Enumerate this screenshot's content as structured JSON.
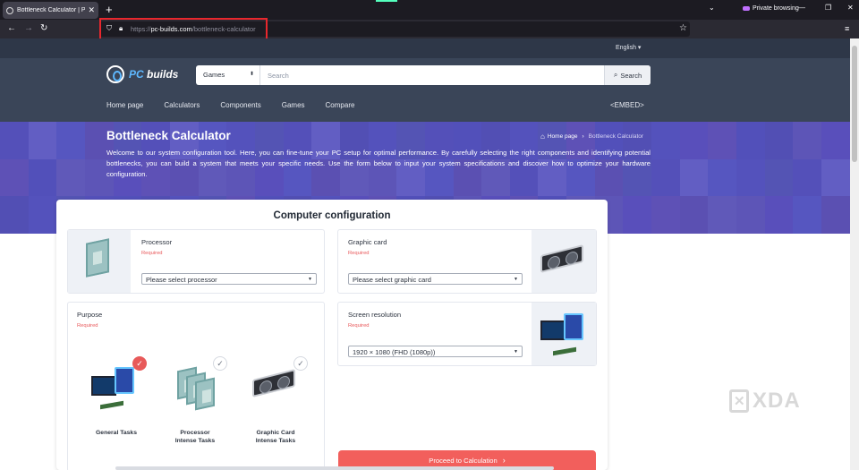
{
  "browser": {
    "tab_title": "Bottleneck Calculator | PC Builds",
    "new_tab": "+",
    "private_label": "Private browsing",
    "url_prefix": "https://",
    "url_domain": "pc-builds.com",
    "url_path": "/bottleneck-calculator"
  },
  "site": {
    "language": "English",
    "logo_prefix": "PC",
    "logo_suffix": " builds",
    "search": {
      "category": "Games",
      "placeholder": "Search",
      "button_label": "Search"
    },
    "nav": [
      "Home page",
      "Calculators",
      "Components",
      "Games",
      "Compare"
    ],
    "embed_label": "<EMBED>"
  },
  "hero": {
    "title": "Bottleneck Calculator",
    "breadcrumb_home": "Home page",
    "breadcrumb_current": "Bottleneck Calculator",
    "description": "Welcome to our system configuration tool. Here, you can fine-tune your PC setup for optimal performance. By carefully selecting the right components and identifying potential bottlenecks, you can build a system that meets your specific needs. Use the form below to input your system specifications and discover how to optimize your hardware configuration."
  },
  "config": {
    "title": "Computer configuration",
    "required_text": "Required",
    "processor": {
      "label": "Processor",
      "placeholder": "Please select processor"
    },
    "graphic_card": {
      "label": "Graphic card",
      "placeholder": "Please select graphic card"
    },
    "purpose": {
      "label": "Purpose",
      "options": [
        {
          "line1": "General Tasks",
          "line2": "",
          "selected": true
        },
        {
          "line1": "Processor",
          "line2": "Intense Tasks",
          "selected": false
        },
        {
          "line1": "Graphic Card",
          "line2": "Intense Tasks",
          "selected": false
        }
      ]
    },
    "resolution": {
      "label": "Screen resolution",
      "value": "1920 × 1080 (FHD (1080p))"
    },
    "proceed_label": "Proceed to Calculation"
  },
  "watermark": "XDA",
  "colors": {
    "hero_accent": "#5c56ce",
    "header_bg": "#3a4558",
    "proceed_button": "#f25f5c",
    "required_text": "#e8585a",
    "url_highlight": "#e8272d"
  }
}
